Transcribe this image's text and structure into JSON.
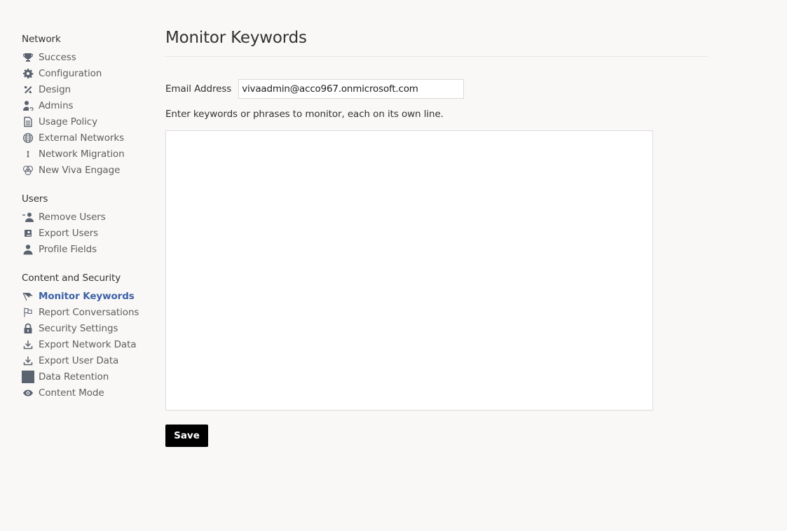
{
  "sidebar": {
    "sections": [
      {
        "title": "Network",
        "items": [
          {
            "label": "Success",
            "icon": "trophy-icon"
          },
          {
            "label": "Configuration",
            "icon": "gear-icon"
          },
          {
            "label": "Design",
            "icon": "design-tools-icon"
          },
          {
            "label": "Admins",
            "icon": "admin-user-icon"
          },
          {
            "label": "Usage Policy",
            "icon": "document-icon"
          },
          {
            "label": "External Networks",
            "icon": "globe-icon"
          },
          {
            "label": "Network Migration",
            "icon": "up-down-arrow-icon"
          },
          {
            "label": "New Viva Engage",
            "icon": "viva-engage-icon"
          }
        ]
      },
      {
        "title": "Users",
        "items": [
          {
            "label": "Remove Users",
            "icon": "remove-user-icon"
          },
          {
            "label": "Export Users",
            "icon": "export-users-icon"
          },
          {
            "label": "Profile Fields",
            "icon": "user-icon"
          }
        ]
      },
      {
        "title": "Content and Security",
        "items": [
          {
            "label": "Monitor Keywords",
            "icon": "flag-filled-icon",
            "active": true
          },
          {
            "label": "Report Conversations",
            "icon": "flag-outline-icon"
          },
          {
            "label": "Security Settings",
            "icon": "lock-icon"
          },
          {
            "label": "Export Network Data",
            "icon": "download-icon"
          },
          {
            "label": "Export User Data",
            "icon": "download-icon"
          },
          {
            "label": "Data Retention",
            "icon": "data-retention-icon"
          },
          {
            "label": "Content Mode",
            "icon": "eye-icon"
          }
        ]
      }
    ]
  },
  "main": {
    "title": "Monitor Keywords",
    "email_label": "Email Address",
    "email_value": "vivaadmin@acco967.onmicrosoft.com",
    "help_text": "Enter keywords or phrases to monitor, each on its own line.",
    "keywords_value": "",
    "save_label": "Save"
  },
  "colors": {
    "background": "#f9f8f6",
    "active_link": "#3d62a8",
    "icon": "#5c6370",
    "save_button": "#000000"
  }
}
